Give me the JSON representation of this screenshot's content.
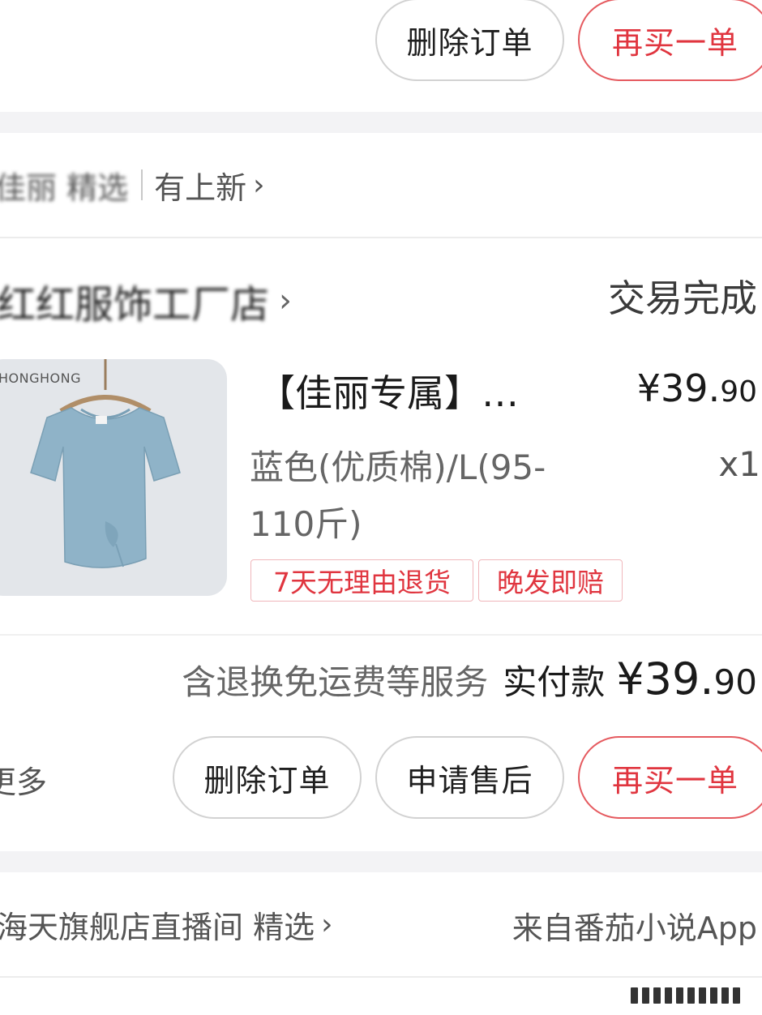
{
  "order_top": {
    "actions": {
      "delete": "删除订单",
      "rebuy": "再买一单"
    }
  },
  "order_main": {
    "source": {
      "name": "佳丽 精选",
      "new_tag": "有上新"
    },
    "shop": {
      "name": "红红服饰工厂店",
      "status": "交易完成"
    },
    "product": {
      "image_brand": "HONGHONG",
      "image_color": "#8fb3c8",
      "title": "【佳丽专属】…",
      "price": "¥39.",
      "price_decimal": "90",
      "variant_line1": "蓝色(优质棉)/L(95-",
      "variant_line2": "110斤)",
      "quantity": "x1",
      "tags": [
        "7天无理由退货",
        "晚发即赔"
      ]
    },
    "summary": {
      "service_note": "含退换免运费等服务",
      "paid_label": "实付款",
      "paid_amount": "¥39.",
      "paid_decimal": "90"
    },
    "actions": {
      "more": "更多",
      "delete": "删除订单",
      "after_sale": "申请售后",
      "rebuy": "再买一单"
    }
  },
  "order_next": {
    "source": {
      "name": "海天旗舰店直播间 精选"
    },
    "origin": "来自番茄小说App"
  },
  "colors": {
    "accent": "#e0353f",
    "page_gap": "#f3f3f5",
    "muted_text": "#555555"
  }
}
